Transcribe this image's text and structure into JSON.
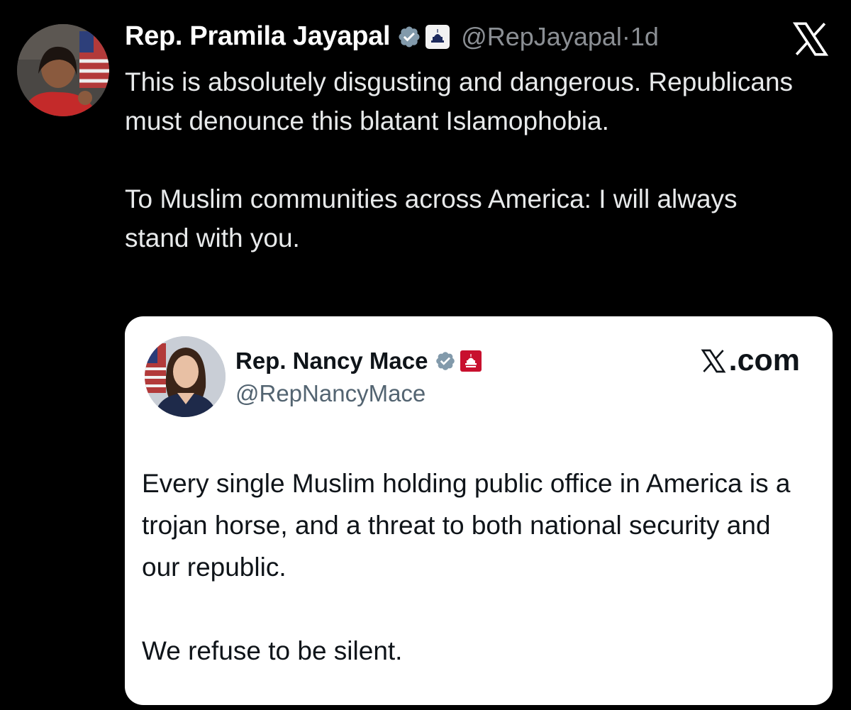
{
  "tweet": {
    "author_name": "Rep. Pramila Jayapal",
    "handle": "@RepJayapal",
    "separator": "·",
    "time": "1d",
    "text_paragraphs": [
      "This is absolutely disgusting and dangerous. Republicans must denounce this blatant Islamophobia.",
      "To Muslim communities across America: I will always stand with you."
    ]
  },
  "quoted_tweet": {
    "author_name": "Rep. Nancy Mace",
    "handle": "@RepNancyMace",
    "source_label": ".com",
    "text_paragraphs": [
      "Every single Muslim holding public office in America is a trojan horse, and a threat to both national security and our republic.",
      "We refuse to be silent."
    ]
  },
  "icons": {
    "verified": "verified-badge-icon",
    "affiliation_main": "capitol-affiliation-icon",
    "affiliation_quote": "gop-affiliation-icon",
    "brand": "x-logo-icon"
  },
  "colors": {
    "background": "#000000",
    "verified_badge": "#829aab",
    "card_background": "#ffffff",
    "handle_gray": "#8b8f94",
    "gop_red": "#c8102e"
  }
}
